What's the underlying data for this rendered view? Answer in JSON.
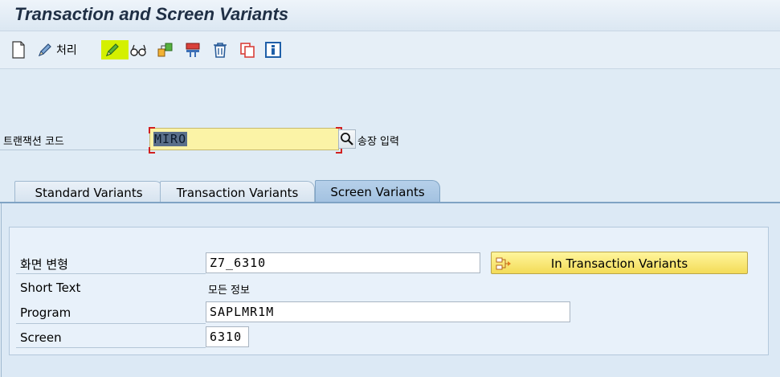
{
  "window": {
    "title": "Transaction and Screen Variants"
  },
  "toolbar": {
    "items": [
      {
        "icon": "new-document-icon"
      },
      {
        "icon": "pencil-icon",
        "label": "처리"
      },
      {
        "icon": "change-pencil-icon",
        "highlighted": true
      },
      {
        "icon": "display-glasses-icon"
      },
      {
        "icon": "object-icon"
      },
      {
        "icon": "transport-icon"
      },
      {
        "icon": "trash-icon"
      },
      {
        "icon": "copy-icon"
      },
      {
        "icon": "info-icon"
      }
    ]
  },
  "transaction": {
    "label": "트랜잭션 코드",
    "value": "MIRO",
    "description": "송장 입력"
  },
  "tabs": [
    {
      "label": "Standard Variants",
      "active": false
    },
    {
      "label": "Transaction Variants",
      "active": false
    },
    {
      "label": "Screen Variants",
      "active": true
    }
  ],
  "screen_variant": {
    "fields": {
      "variant_label": "화면 변형",
      "variant_value": "Z7_6310",
      "short_text_label": "Short Text",
      "short_text_value": "모든 정보",
      "program_label": "Program",
      "program_value": "SAPLMR1M",
      "screen_label": "Screen",
      "screen_value": "6310"
    },
    "button_label": "In Transaction Variants"
  },
  "colors": {
    "accent_highlight": "#d4f000",
    "required_field": "#fbf3a6",
    "active_tab": "#a2c1e0",
    "button_yellow": "#f3dc58"
  }
}
